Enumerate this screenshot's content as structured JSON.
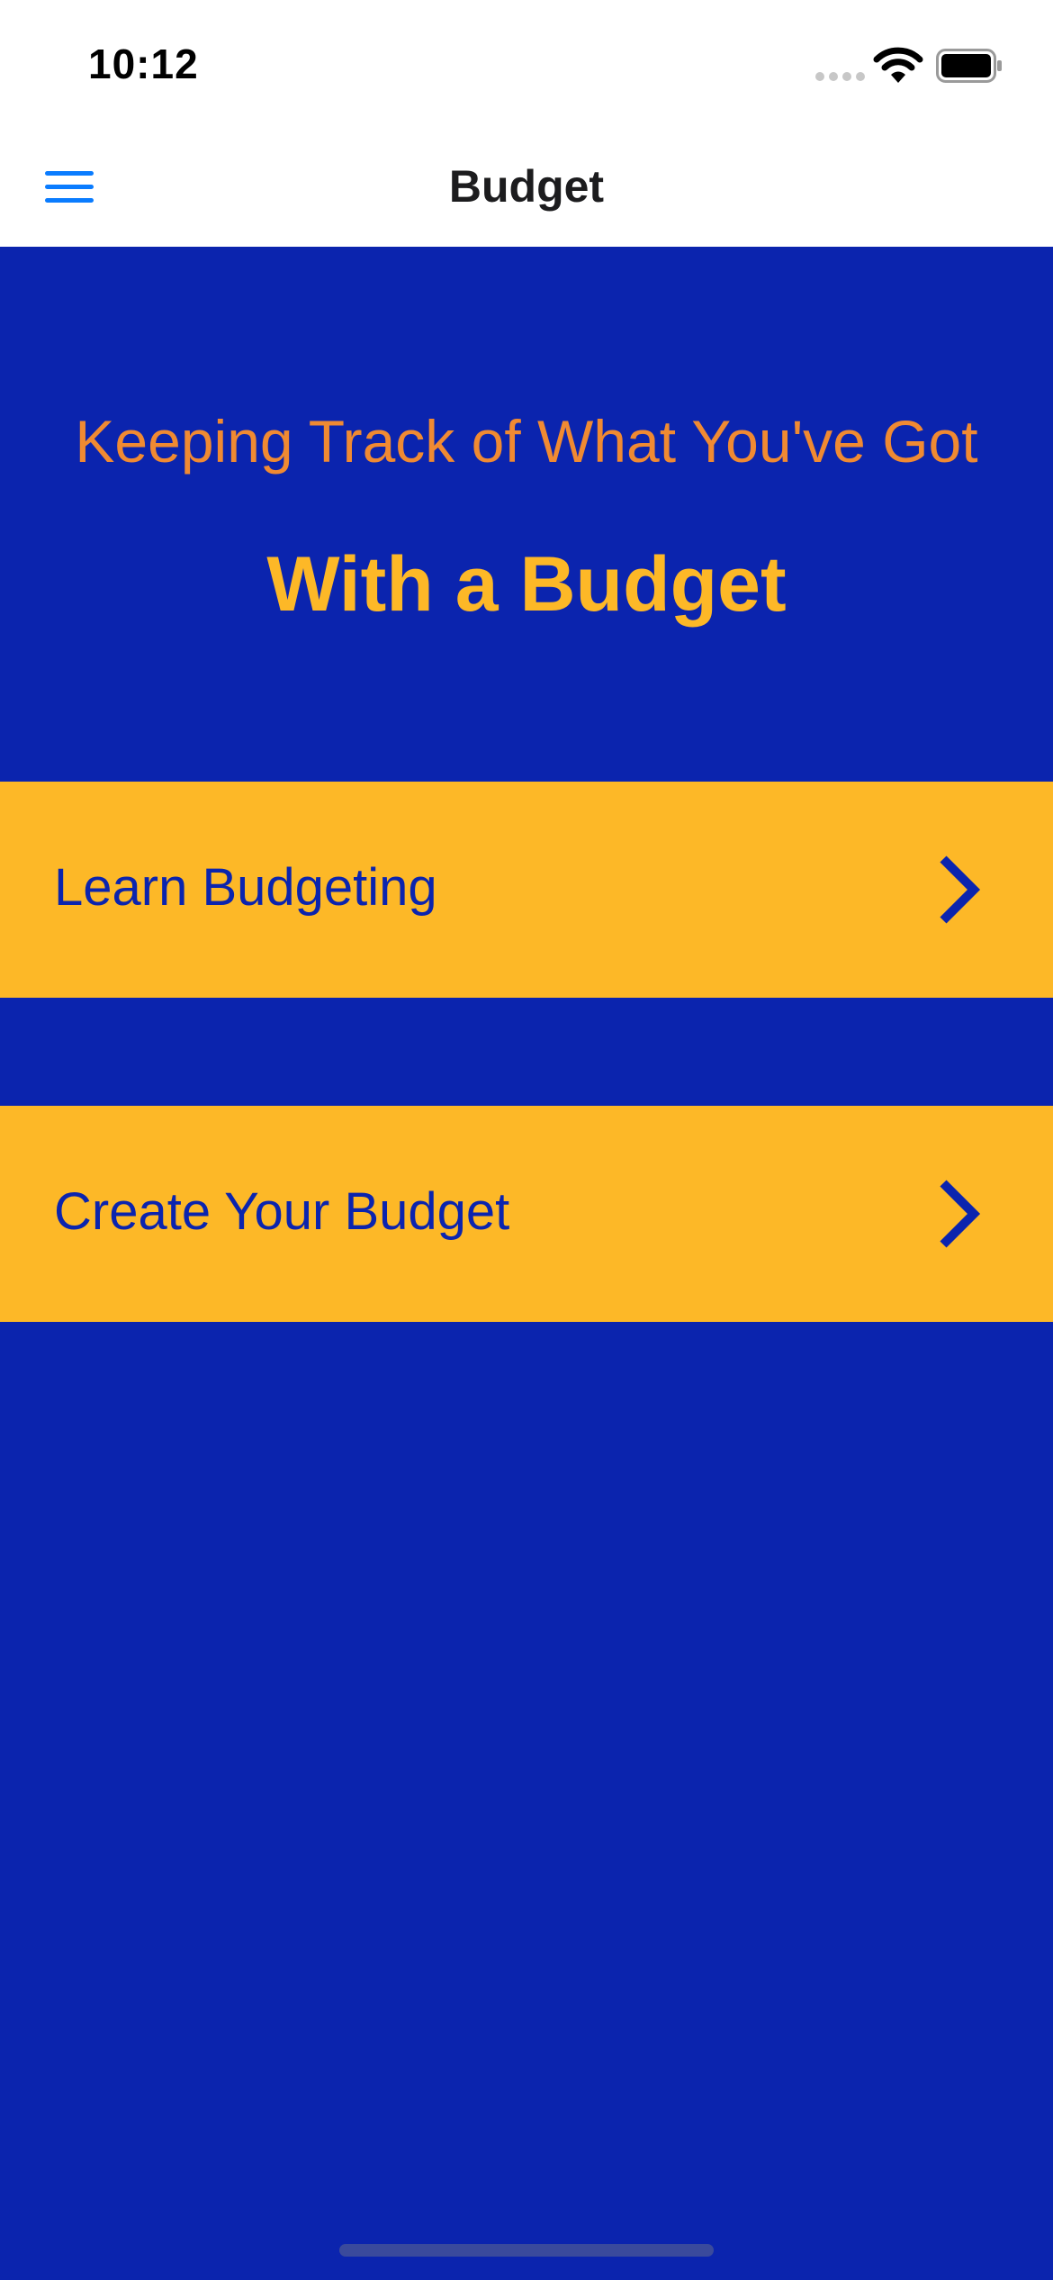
{
  "status_bar": {
    "time": "10:12"
  },
  "nav": {
    "title": "Budget",
    "menu_icon": "hamburger-menu-icon"
  },
  "hero": {
    "subtitle": "Keeping Track of What You've Got",
    "title": "With a Budget"
  },
  "menu": {
    "items": [
      {
        "label": "Learn Budgeting",
        "icon": "chevron-right-icon"
      },
      {
        "label": "Create Your Budget",
        "icon": "chevron-right-icon"
      }
    ]
  },
  "colors": {
    "background": "#0b24ae",
    "row_background": "#fdb827",
    "subtitle": "#f08a32",
    "title": "#fdb827",
    "row_text": "#0b24ae",
    "accent": "#0a7cff"
  }
}
